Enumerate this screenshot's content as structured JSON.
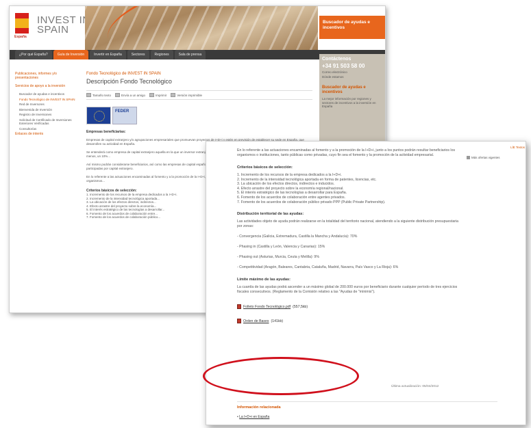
{
  "back": {
    "flag_caption": "España",
    "logo": {
      "line1": "INVEST IN",
      "line2": "SPAIN"
    },
    "promo": "Buscador de ayudas e incentivos",
    "nav_tabs": [
      {
        "label": "¿Por qué España?"
      },
      {
        "label": "Guía de Inversión"
      },
      {
        "label": "Invertir en España"
      },
      {
        "label": "Sectores"
      },
      {
        "label": "Regiones"
      },
      {
        "label": "Sala de prensa"
      }
    ],
    "left_links": [
      "Publicaciones, informes y/o presentaciones",
      "Servicios de apoyo a la inversión"
    ],
    "left_sub": [
      "Buscador de ayudas e incentivos",
      "Fondo Tecnológico de INVEST IN SPAIN",
      "Red de Inversores",
      "Bienvenida de Inversión",
      "Registro de Inversiones",
      "Solicitud de Certificado de Inversiones Exteriores Verificadas",
      "Consultorías"
    ],
    "left_link_last": "Enlaces de interés",
    "contact": {
      "title": "Contáctenos",
      "phone": "+34 91 503 58 00",
      "links": [
        "Correo electrónico",
        "Dónde estamos"
      ]
    },
    "buscador": {
      "title": "Buscador de ayudas e incentivos",
      "text": "La mejor información por regiones y sectores de incentivos a la inversión en España"
    },
    "crumb": "Fondo Tecnológico de INVEST IN SPAIN",
    "title": "Descripción Fondo Tecnológico",
    "tools": [
      "Tamaño texto",
      "Envía a un amigo",
      "Imprimir",
      "Versión imprimible"
    ],
    "feder": "FEDER",
    "heading1": "Empresas beneficiarias:",
    "para1": "Empresas de capital extranjero y/o agrupaciones empresariales que promuevan proyectos de I+D+i y estén en previsión de establecer su sede en España, que desarrollen su actividad en España.",
    "para2": "Se entenderá como empresa de capital extranjero aquella en la que un inversor extranjero residente fuera de España tenga una participación en su capital de, al menos, un 10%...",
    "para3": "Así mismo podrán considerarse beneficiarios, así como las empresas de capital español participadas por capital extranjero, las agrupaciones de interés económico participadas por capital extranjero.",
    "para4": "En lo referente a las actuaciones encaminadas al fomento y a la promoción de la I+D+i, junto a las anteriores, los puntos podrán resultar beneficiarios los organismos...",
    "heading2": "Criterios básicos de selección:",
    "list": [
      "1. Incremento de los recursos de la empresa dedicados a la I+D+i.",
      "2. Incremento de la intensidad tecnológica aportada...",
      "3. La ubicación de los efectos directos, indirectos...",
      "4. Efecto arrastre del proyecto sobre la economía...",
      "5. El interés estratégico de las tecnologías a desarrollar...",
      "6. Fomento de los acuerdos de colaboración entre...",
      "7. Fomento de los acuerdos de colaboración público..."
    ]
  },
  "front": {
    "intro": "En lo referente a las actuaciones encaminadas al fomento y a la promoción de la I+D+i, junto a los puntos podrán resultar beneficiarios los organismos o instituciones, tanto públicas como privadas, cuyo fin sea el fomento y la promoción de la actividad empresarial.",
    "criteria_title": "Criterios básicos de selección:",
    "criteria": [
      "1. Incremento de los recursos de la empresa dedicados a la I+D+i.",
      "2. Incremento de la intensidad tecnológica aportada en forma de patentes, licencias, etc.",
      "3. La ubicación de los efectos directos, indirectos e inducidos.",
      "4. Efecto arrastre del proyecto sobre la economía regional/nacional.",
      "5. El interés estratégico de las tecnologías a desarrollar para España.",
      "6. Fomento de los acuerdos de colaboración entre agentes privados.",
      "7. Fomento de los acuerdos de colaboración público privado PPP (Public Private Partnership)."
    ],
    "distribution_title": "Distribución territorial de las ayudas:",
    "distribution_text": "Las actividades objeto de ayuda podrán realizarse en la totalidad del territorio nacional, atendiendo a la siguiente distribución presupuestaria por zonas:",
    "zones": [
      "- Convergencia (Galicia, Extremadura, Castilla la Mancha y Andalucía): 70%",
      "- Phasing in (Castilla y León, Valencia y Canarias): 15%",
      "- Phasing out (Asturias, Murcia, Ceuta y Melilla): 9%",
      "- Competitividad (Aragón, Baleares, Cantabria, Cataluña, Madrid, Navarra, País Vasco y La Rioja): 6%"
    ],
    "limit_title": "Límite máximo de las ayudas:",
    "limit_text": "La cuantía de las ayudas podrá ascender a un máximo global de 200.000 euros por beneficiario durante cualquier período de tres ejercicios fiscales consecutivos. (Reglamento de la Comisión relativo a las \"Ayudas de \"mínimis\").",
    "downloads": [
      {
        "name": "Folleto Fondo Tecnológico.pdf",
        "size": "(557,5kb)"
      },
      {
        "name": "Orden de Bases",
        "size": "(141kb)"
      }
    ],
    "updated": "Última actualización: 05/04/2012",
    "related_title": "Información relacionada",
    "related_link": "La I+D+i en España",
    "right_top": "LÍE Textos",
    "right_rel": "Más ofertas vigentes"
  }
}
